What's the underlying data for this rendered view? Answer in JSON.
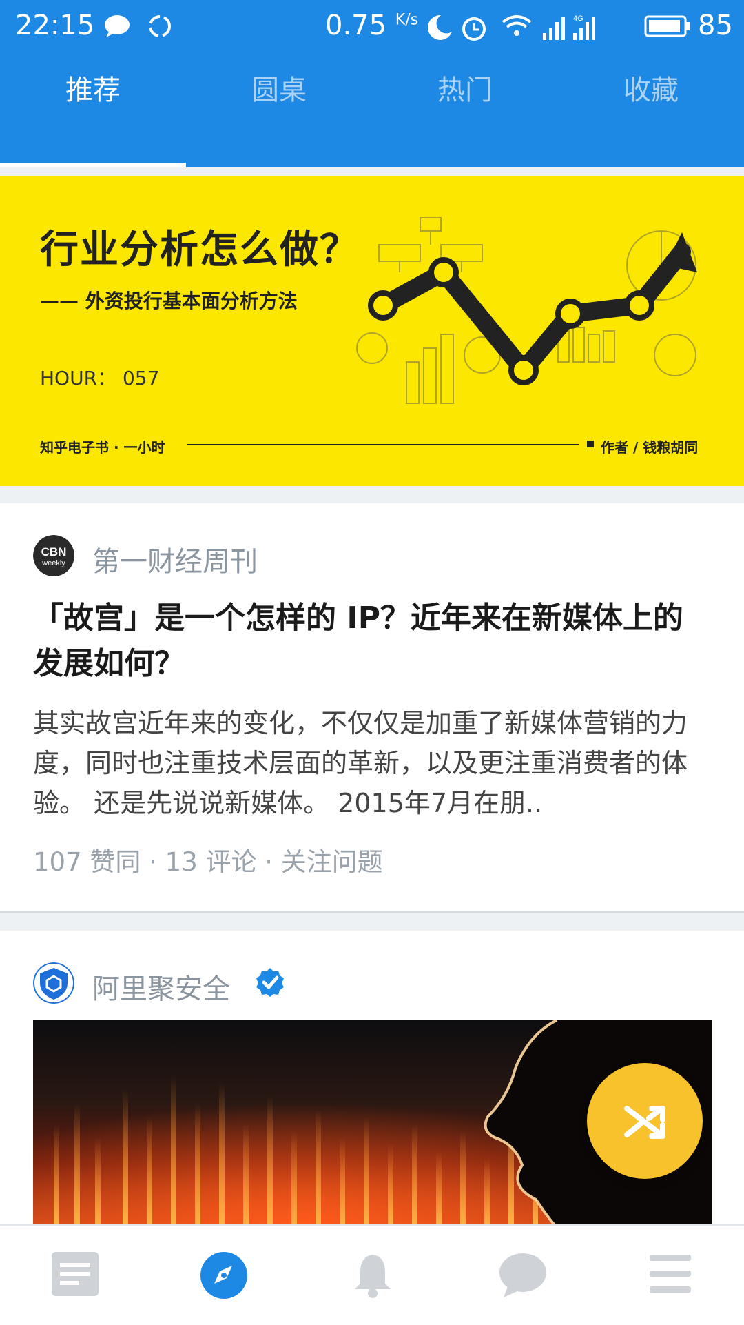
{
  "status_bar": {
    "time": "22:15",
    "speed": "0.75",
    "speed_unit": "K/s",
    "battery": "85",
    "icons": [
      "message-icon",
      "sync-icon",
      "moon-icon",
      "alarm-icon",
      "wifi-icon",
      "signal-icon",
      "signal-4g-icon",
      "battery-icon"
    ]
  },
  "tabs": [
    {
      "label": "推荐",
      "active": true
    },
    {
      "label": "圆桌",
      "active": false
    },
    {
      "label": "热门",
      "active": false
    },
    {
      "label": "收藏",
      "active": false
    }
  ],
  "banner": {
    "title": "行业分析怎么做？",
    "subtitle": "—— 外资投行基本面分析方法",
    "hour": "HOUR： 057",
    "footer_left": "知乎电子书 · 一小时",
    "footer_right": "作者 / 钱粮胡同",
    "background": "#fce700"
  },
  "feed": [
    {
      "author": "第一财经周刊",
      "avatar_text": "CBN weekly",
      "title": "「故宫」是一个怎样的 IP？近年来在新媒体上的发展如何？",
      "excerpt": "其实故宫近年来的变化，不仅仅是加重了新媒体营销的力度，同时也注重技术层面的革新，以及更注重消费者的体验。 还是先说说新媒体。 2015年7月在朋..",
      "meta": "107 赞同 · 13 评论 · 关注问题"
    },
    {
      "author": "阿里聚安全",
      "verified": true
    }
  ],
  "fab": {
    "icon": "shuffle-icon",
    "color": "#f7c22b"
  },
  "bottom_nav": [
    {
      "icon": "feed-icon",
      "active": false
    },
    {
      "icon": "explore-compass-icon",
      "active": true
    },
    {
      "icon": "notification-bell-icon",
      "active": false
    },
    {
      "icon": "message-bubble-icon",
      "active": false
    },
    {
      "icon": "menu-icon",
      "active": false
    }
  ],
  "colors": {
    "primary": "#1e88e5",
    "accent": "#f7c22b",
    "inactive_icon": "#cfd3d7"
  }
}
